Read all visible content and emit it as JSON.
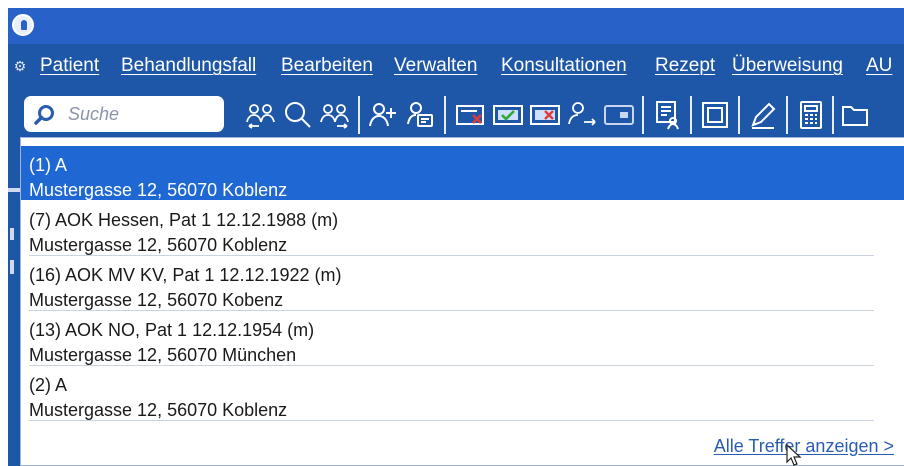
{
  "menubar": {
    "items": [
      {
        "label": "Patient"
      },
      {
        "label": "Behandlungsfall"
      },
      {
        "label": "Bearbeiten"
      },
      {
        "label": "Verwalten"
      },
      {
        "label": "Konsultationen"
      },
      {
        "label": "Rezept"
      },
      {
        "label": "Überweisung"
      },
      {
        "label": "AU"
      }
    ]
  },
  "search": {
    "placeholder": "Suche",
    "value": ""
  },
  "toolbar": {
    "icons": [
      "patient-swap-left-icon",
      "search-icon",
      "patient-swap-right-icon",
      "add-patient-icon",
      "patient-card-icon",
      "card-reader-red-icon",
      "card-reader-green-icon",
      "card-reader-cross-icon",
      "patient-forward-icon",
      "card-icon",
      "document-person-icon",
      "frame-icon",
      "pen-icon",
      "calculator-icon",
      "folder-icon"
    ]
  },
  "results": [
    {
      "line1": "(1) A",
      "line2": "Mustergasse 12, 56070 Koblenz",
      "selected": true
    },
    {
      "line1": "(7) AOK Hessen, Pat 1  12.12.1988 (m)",
      "line2": "Mustergasse 12, 56070 Koblenz",
      "selected": false
    },
    {
      "line1": "(16) AOK MV KV, Pat 1  12.12.1922 (m)",
      "line2": "Mustergasse 12, 56070 Kobenz",
      "selected": false
    },
    {
      "line1": "(13) AOK NO, Pat 1  12.12.1954 (m)",
      "line2": "Mustergasse 12, 56070 München",
      "selected": false
    },
    {
      "line1": "(2) A",
      "line2": "Mustergasse 12, 56070 Koblenz",
      "selected": false
    }
  ],
  "all_results_link": "Alle Treffer anzeigen >",
  "colors": {
    "frame": "#1e56a8",
    "titlebar": "#2862c9",
    "selection": "#1f68d4",
    "link": "#2a5db0"
  }
}
